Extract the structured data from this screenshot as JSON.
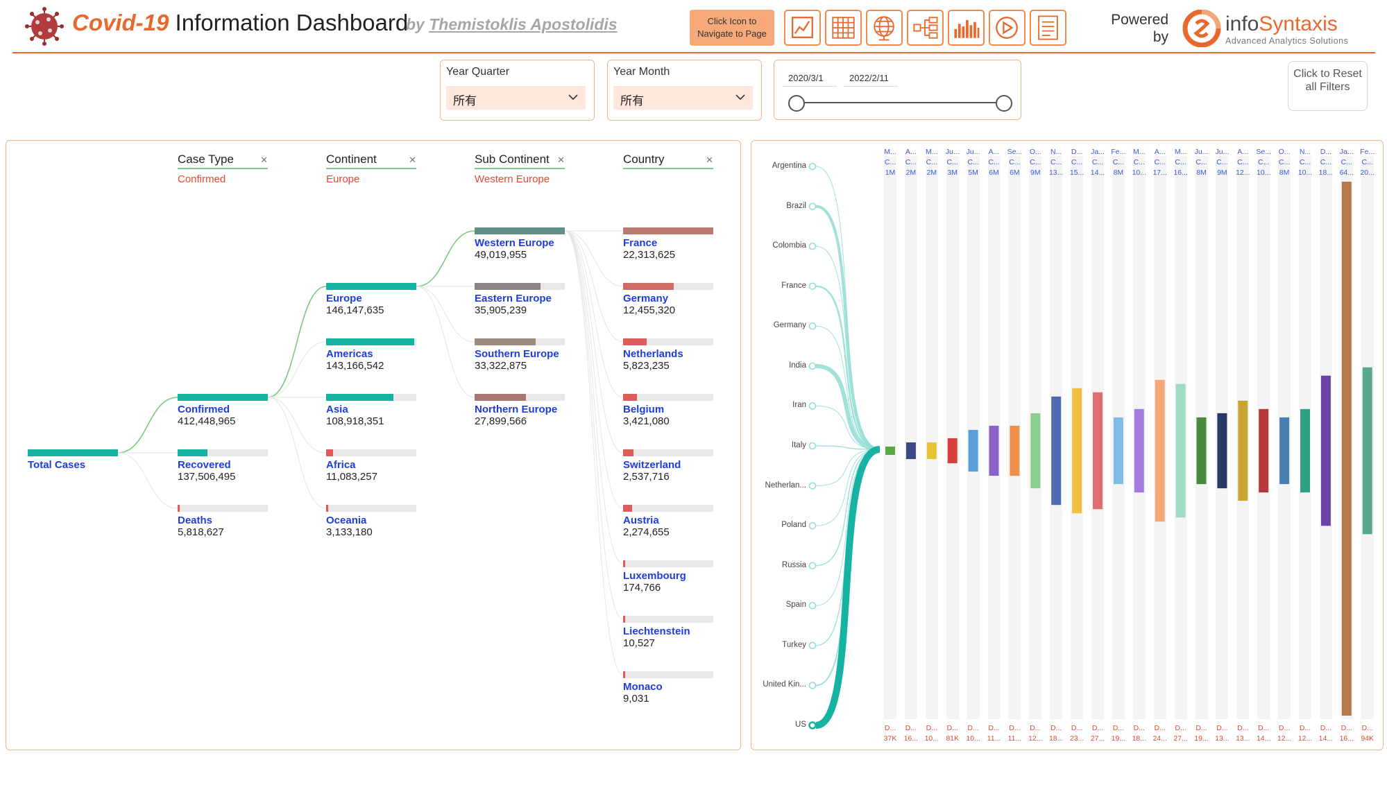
{
  "header": {
    "title_covid": "Covid-19",
    "title_rest": "Information Dashboard",
    "byline_prefix": "by",
    "author": "Themistoklis Apostolidis",
    "nav_hint": "Click Icon to Navigate to Page",
    "powered_by": "Powered by",
    "brand_info": "info",
    "brand_syntaxis": "Syntaxis",
    "brand_tagline": "Advanced Analytics Solutions",
    "accent_color": "#e8692e",
    "nav_icons": [
      "line-chart-icon",
      "table-grid-icon",
      "globe-icon",
      "hierarchy-icon",
      "bar-chart-icon",
      "play-icon",
      "report-icon"
    ]
  },
  "filters": {
    "year_quarter": {
      "label": "Year Quarter",
      "value": "所有"
    },
    "year_month": {
      "label": "Year Month",
      "value": "所有"
    },
    "date_range": {
      "start": "2020/3/1",
      "end": "2022/2/11"
    },
    "reset_label": "Click to Reset all Filters"
  },
  "tree": {
    "columns": [
      {
        "header": "Case Type",
        "selected": "Confirmed"
      },
      {
        "header": "Continent",
        "selected": "Europe"
      },
      {
        "header": "Sub Continent",
        "selected": "Western Europe"
      },
      {
        "header": "Country",
        "selected": ""
      }
    ],
    "root": {
      "name": "Total Cases"
    },
    "case_types": [
      {
        "name": "Confirmed",
        "value": "412,448,965",
        "num": 412448965,
        "color": "#16b3a3"
      },
      {
        "name": "Recovered",
        "value": "137,506,495",
        "num": 137506495,
        "color": "#16b3a3"
      },
      {
        "name": "Deaths",
        "value": "5,818,627",
        "num": 5818627,
        "color": "#e05c5c"
      }
    ],
    "continents": [
      {
        "name": "Europe",
        "value": "146,147,635",
        "num": 146147635,
        "color": "#16b3a3"
      },
      {
        "name": "Americas",
        "value": "143,166,542",
        "num": 143166542,
        "color": "#16b3a3"
      },
      {
        "name": "Asia",
        "value": "108,918,351",
        "num": 108918351,
        "color": "#16b3a3"
      },
      {
        "name": "Africa",
        "value": "11,083,257",
        "num": 11083257,
        "color": "#e05c5c"
      },
      {
        "name": "Oceania",
        "value": "3,133,180",
        "num": 3133180,
        "color": "#e05c5c"
      }
    ],
    "sub_continents": [
      {
        "name": "Western Europe",
        "value": "49,019,955",
        "num": 49019955,
        "color": "#5f8f87"
      },
      {
        "name": "Eastern Europe",
        "value": "35,905,239",
        "num": 35905239,
        "color": "#8a8580"
      },
      {
        "name": "Southern Europe",
        "value": "33,322,875",
        "num": 33322875,
        "color": "#9b8c80"
      },
      {
        "name": "Northern Europe",
        "value": "27,899,566",
        "num": 27899566,
        "color": "#a87870"
      }
    ],
    "countries": [
      {
        "name": "France",
        "value": "22,313,625",
        "num": 22313625,
        "color": "#b97a72"
      },
      {
        "name": "Germany",
        "value": "12,455,320",
        "num": 12455320,
        "color": "#cf6c66"
      },
      {
        "name": "Netherlands",
        "value": "5,823,235",
        "num": 5823235,
        "color": "#e05c5c"
      },
      {
        "name": "Belgium",
        "value": "3,421,080",
        "num": 3421080,
        "color": "#e05c5c"
      },
      {
        "name": "Switzerland",
        "value": "2,537,716",
        "num": 2537716,
        "color": "#e05c5c"
      },
      {
        "name": "Austria",
        "value": "2,274,655",
        "num": 2274655,
        "color": "#e05c5c"
      },
      {
        "name": "Luxembourg",
        "value": "174,766",
        "num": 174766,
        "color": "#e05c5c"
      },
      {
        "name": "Liechtenstein",
        "value": "10,527",
        "num": 10527,
        "color": "#e05c5c"
      },
      {
        "name": "Monaco",
        "value": "9,031",
        "num": 9031,
        "color": "#e05c5c"
      }
    ]
  },
  "chart_data": {
    "type": "area",
    "countries": [
      "Argentina",
      "Brazil",
      "Colombia",
      "France",
      "Germany",
      "India",
      "Iran",
      "Italy",
      "Netherlan...",
      "Poland",
      "Russia",
      "Spain",
      "Turkey",
      "United Kin...",
      "US"
    ],
    "top_labels": [
      [
        "M...",
        "C...",
        "1M"
      ],
      [
        "A...",
        "C...",
        "2M"
      ],
      [
        "M...",
        "C...",
        "2M"
      ],
      [
        "Ju...",
        "C...",
        "3M"
      ],
      [
        "Ju...",
        "C...",
        "5M"
      ],
      [
        "A...",
        "C...",
        "6M"
      ],
      [
        "Se...",
        "C...",
        "6M"
      ],
      [
        "O...",
        "C...",
        "9M"
      ],
      [
        "N...",
        "C...",
        "13..."
      ],
      [
        "D...",
        "C...",
        "15..."
      ],
      [
        "Ja...",
        "C...",
        "14..."
      ],
      [
        "Fe...",
        "C...",
        "8M"
      ],
      [
        "M...",
        "C...",
        "10..."
      ],
      [
        "A...",
        "C...",
        "17..."
      ],
      [
        "M...",
        "C...",
        "16..."
      ],
      [
        "Ju...",
        "C...",
        "8M"
      ],
      [
        "Ju...",
        "C...",
        "9M"
      ],
      [
        "A...",
        "C...",
        "12..."
      ],
      [
        "Se...",
        "C...",
        "10..."
      ],
      [
        "O...",
        "C...",
        "8M"
      ],
      [
        "N...",
        "C...",
        "10..."
      ],
      [
        "D...",
        "C...",
        "18..."
      ],
      [
        "Ja...",
        "C...",
        "64..."
      ],
      [
        "Fe...",
        "C...",
        "20..."
      ]
    ],
    "bottom_labels": [
      [
        "D...",
        "37K"
      ],
      [
        "D...",
        "16..."
      ],
      [
        "D...",
        "10..."
      ],
      [
        "D...",
        "81K"
      ],
      [
        "D...",
        "10..."
      ],
      [
        "D...",
        "11..."
      ],
      [
        "D...",
        "11..."
      ],
      [
        "D...",
        "12..."
      ],
      [
        "D...",
        "18..."
      ],
      [
        "D...",
        "23..."
      ],
      [
        "D...",
        "27..."
      ],
      [
        "D...",
        "19..."
      ],
      [
        "D...",
        "18..."
      ],
      [
        "D...",
        "24..."
      ],
      [
        "D...",
        "27..."
      ],
      [
        "D...",
        "19..."
      ],
      [
        "D...",
        "13..."
      ],
      [
        "D...",
        "13..."
      ],
      [
        "D...",
        "14..."
      ],
      [
        "D...",
        "12..."
      ],
      [
        "D...",
        "12..."
      ],
      [
        "D...",
        "14..."
      ],
      [
        "D...",
        "16..."
      ],
      [
        "D...",
        "94K"
      ]
    ],
    "bar_values_millions": [
      1,
      2,
      2,
      3,
      5,
      6,
      6,
      9,
      13,
      15,
      14,
      8,
      10,
      17,
      16,
      8,
      9,
      12,
      10,
      8,
      10,
      18,
      64,
      20
    ],
    "bar_colors": [
      "#5aa845",
      "#3b4a86",
      "#e7c33a",
      "#d9413f",
      "#5b9ede",
      "#8b63c9",
      "#f08e4a",
      "#8ccf8c",
      "#4e6ab0",
      "#f2c040",
      "#e06e6e",
      "#7fbde8",
      "#a57be0",
      "#f5a77a",
      "#9fdcc0",
      "#4b8a3c",
      "#2a3868",
      "#c9a632",
      "#b33a3a",
      "#4c7fb0",
      "#2f9f86",
      "#6a43a8",
      "#b5794a",
      "#5aa88c"
    ],
    "ribbon_color": "#16b3a3",
    "ribbon_light": "#8fdcd4"
  }
}
